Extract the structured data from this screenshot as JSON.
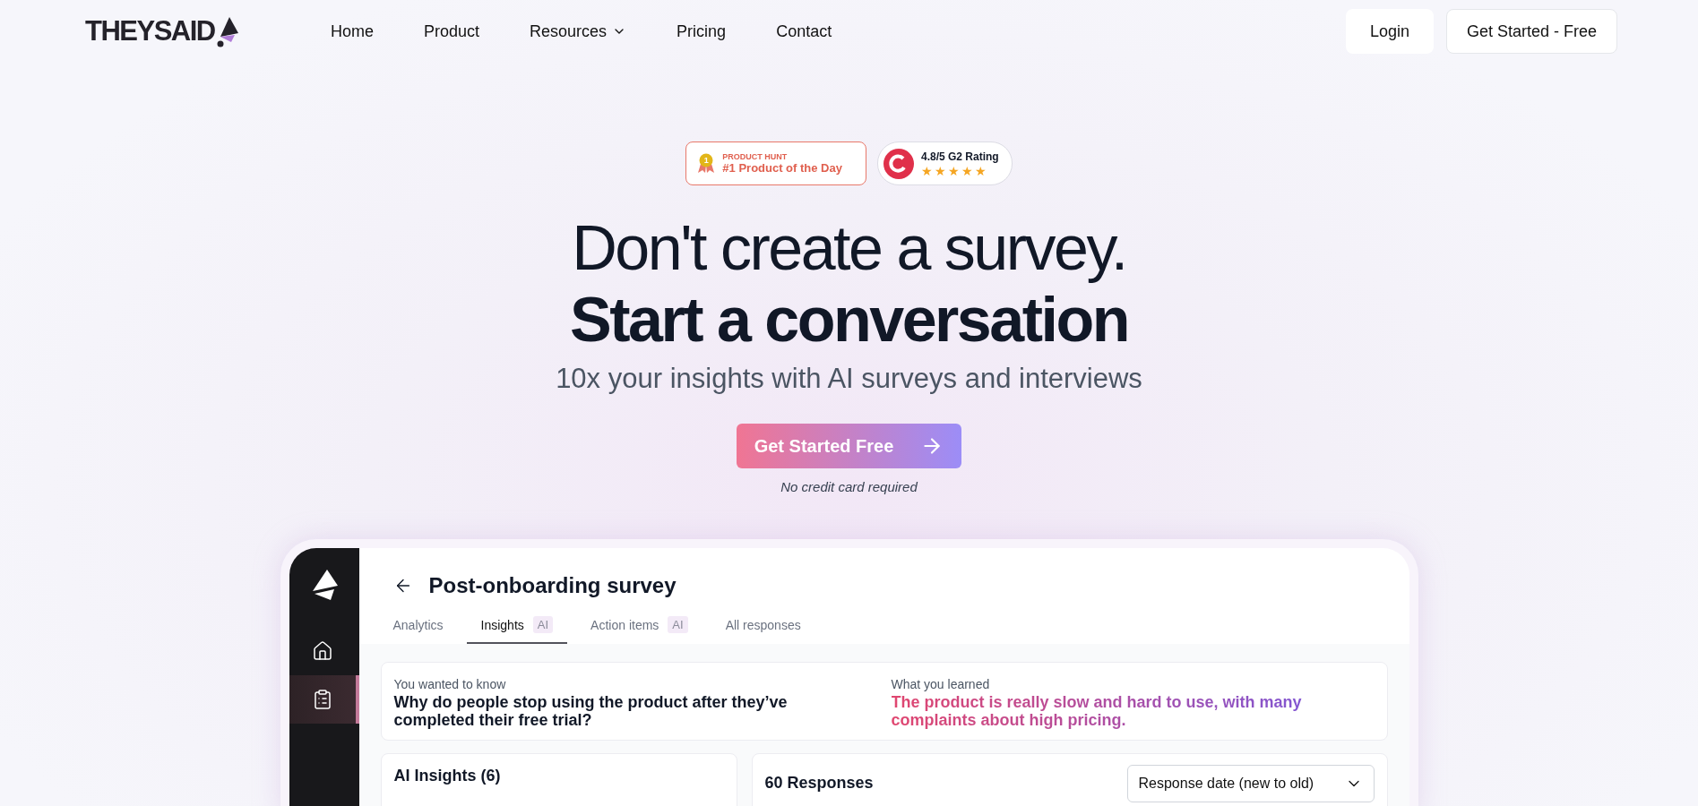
{
  "nav": {
    "logo": "THEYSAID",
    "links": [
      {
        "label": "Home",
        "dropdown": false
      },
      {
        "label": "Product",
        "dropdown": false
      },
      {
        "label": "Resources",
        "dropdown": true
      },
      {
        "label": "Pricing",
        "dropdown": false
      },
      {
        "label": "Contact",
        "dropdown": false
      }
    ],
    "login": "Login",
    "cta": "Get Started - Free"
  },
  "badges": {
    "product_hunt": {
      "eyebrow": "PRODUCT HUNT",
      "title": "#1 Product of the Day",
      "rank": "1"
    },
    "g2": {
      "rating": "4.8/5 G2 Rating",
      "stars": 5
    }
  },
  "hero": {
    "headline": "Don't create a survey.",
    "headline_bold": "Start a conversation",
    "subtitle": "10x your insights with AI surveys and interviews",
    "cta": "Get Started Free",
    "note": "No credit card required"
  },
  "app": {
    "sidebar": [
      {
        "kind": "home",
        "selected": false
      },
      {
        "kind": "surveys",
        "selected": true
      }
    ],
    "title": "Post-onboarding survey",
    "tabs": [
      {
        "label": "Analytics",
        "selected": false
      },
      {
        "label": "Insights",
        "tag": "AI",
        "selected": true
      },
      {
        "label": "Action items",
        "tag": "AI",
        "selected": false
      },
      {
        "label": "All responses",
        "selected": false
      }
    ],
    "summary": {
      "asked_label": "You wanted to know",
      "asked": "Why do people stop using the product after they’ve completed their free trial?",
      "learned_label": "What you learned",
      "learned": "The product is really slow and hard to use, with many complaints about high pricing."
    },
    "insights_title": "AI Insights (6)",
    "responses_title": "60 Responses",
    "sort": "Response date (new to old)"
  }
}
